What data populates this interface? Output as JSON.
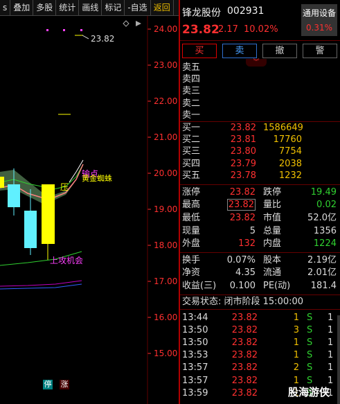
{
  "toolbar": {
    "items": [
      "s",
      "叠加",
      "多股",
      "统计",
      "画线",
      "标记",
      "-自选",
      "返回"
    ]
  },
  "chart": {
    "price_labels": [
      "24.00",
      "23.00",
      "22.00",
      "21.00",
      "20.00",
      "19.00",
      "18.00",
      "17.00",
      "16.00",
      "15.00"
    ],
    "high_label": "23.82",
    "annotations": {
      "loser": "输点",
      "golden": "黄金蜘蛛",
      "pressure": "压",
      "opportunity": "上攻机会"
    },
    "tag_ting": "停",
    "tag_zhang": "涨",
    "colors": {
      "price_axis": "#ff3030",
      "grid": "#600000",
      "ma_green": "#30d030",
      "ma_magenta": "#c000c0",
      "ma_blue": "#3060ff",
      "candle_up": "#ffff00",
      "candle_down": "#60f0ff"
    }
  },
  "header": {
    "name": "锋龙股份",
    "code": "002931",
    "price": "23.82",
    "change": "2.17",
    "change_pct": "10.02%",
    "general_label": "通用设备",
    "general_value": "0.31%"
  },
  "actions": {
    "buy": "买",
    "sell": "卖",
    "cancel": "撤",
    "alert": "警"
  },
  "asks": [
    {
      "label": "卖五",
      "price": "",
      "volume": ""
    },
    {
      "label": "卖四",
      "price": "",
      "volume": ""
    },
    {
      "label": "卖三",
      "price": "",
      "volume": ""
    },
    {
      "label": "卖二",
      "price": "",
      "volume": ""
    },
    {
      "label": "卖一",
      "price": "",
      "volume": ""
    }
  ],
  "bids": [
    {
      "label": "买一",
      "price": "23.82",
      "volume": "1586649"
    },
    {
      "label": "买二",
      "price": "23.81",
      "volume": "17760"
    },
    {
      "label": "买三",
      "price": "23.80",
      "volume": "7754"
    },
    {
      "label": "买四",
      "price": "23.79",
      "volume": "2038"
    },
    {
      "label": "买五",
      "price": "23.78",
      "volume": "1232"
    }
  ],
  "stats1": [
    {
      "l1": "涨停",
      "v1": "23.82",
      "l2": "跌停",
      "v2": "19.49"
    },
    {
      "l1": "最高",
      "v1": "23.82",
      "l2": "量比",
      "v2": "0.02"
    },
    {
      "l1": "最低",
      "v1": "23.82",
      "l2": "市值",
      "v2": "52.0亿"
    },
    {
      "l1": "现量",
      "v1": "5",
      "l2": "总量",
      "v2": "1356"
    },
    {
      "l1": "外盘",
      "v1": "132",
      "l2": "内盘",
      "v2": "1224"
    }
  ],
  "stats2": [
    {
      "l1": "换手",
      "v1": "0.07%",
      "l2": "股本",
      "v2": "2.19亿"
    },
    {
      "l1": "净资",
      "v1": "4.35",
      "l2": "流通",
      "v2": "2.01亿"
    },
    {
      "l1": "收益(三)",
      "v1": "0.100",
      "l2": "PE(动)",
      "v2": "181.4"
    }
  ],
  "status": "交易状态: 闭市阶段 15:00:00",
  "trades": [
    {
      "time": "13:44",
      "price": "23.82",
      "vol": "1",
      "side": "S",
      "n": "1"
    },
    {
      "time": "13:50",
      "price": "23.82",
      "vol": "3",
      "side": "S",
      "n": "1"
    },
    {
      "time": "13:50",
      "price": "23.82",
      "vol": "1",
      "side": "S",
      "n": "1"
    },
    {
      "time": "13:53",
      "price": "23.82",
      "vol": "1",
      "side": "S",
      "n": "1"
    },
    {
      "time": "13:57",
      "price": "23.82",
      "vol": "2",
      "side": "S",
      "n": "1"
    },
    {
      "time": "13:57",
      "price": "23.82",
      "vol": "1",
      "side": "S",
      "n": "1"
    },
    {
      "time": "13:59",
      "price": "23.82",
      "vol": "1",
      "side": "S",
      "n": "1"
    }
  ],
  "watermark": "股海游侠"
}
